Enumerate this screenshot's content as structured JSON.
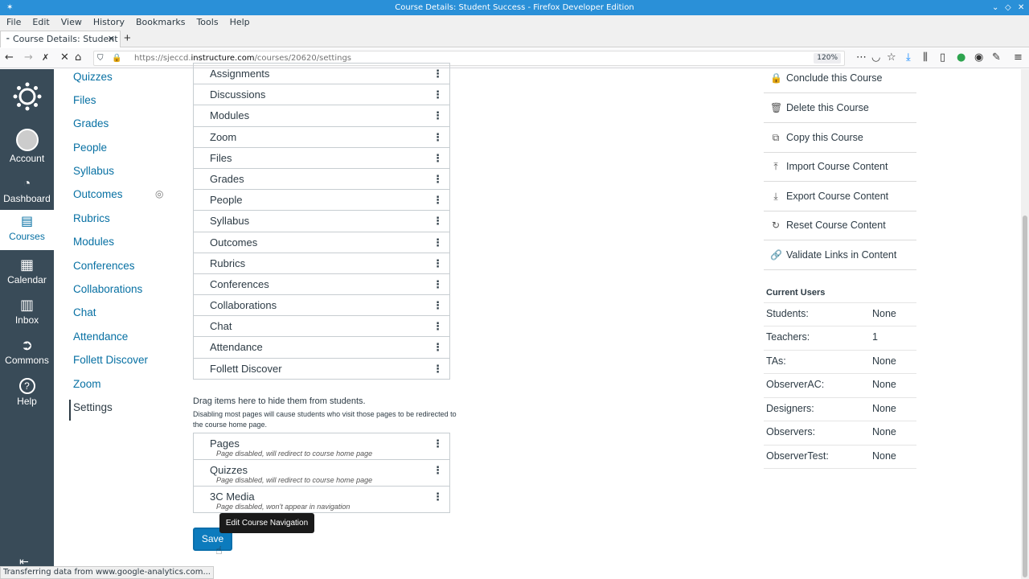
{
  "window": {
    "title": "Course Details: Student Success - Firefox Developer Edition"
  },
  "menubar": [
    "File",
    "Edit",
    "View",
    "History",
    "Bookmarks",
    "Tools",
    "Help"
  ],
  "tab": {
    "title": "Course Details: Student"
  },
  "url": {
    "prefix": "https://sjeccd.",
    "domain": "instructure.com",
    "path": "/courses/20620/settings",
    "zoom": "120%"
  },
  "globalnav": {
    "account": "Account",
    "dashboard": "Dashboard",
    "courses": "Courses",
    "calendar": "Calendar",
    "inbox": "Inbox",
    "commons": "Commons",
    "help": "Help"
  },
  "coursenav": [
    "Quizzes",
    "Files",
    "Grades",
    "People",
    "Syllabus",
    "Outcomes",
    "Rubrics",
    "Modules",
    "Conferences",
    "Collaborations",
    "Chat",
    "Attendance",
    "Follett Discover",
    "Zoom",
    "Settings"
  ],
  "navlist": [
    "Assignments",
    "Discussions",
    "Modules",
    "Zoom",
    "Files",
    "Grades",
    "People",
    "Syllabus",
    "Outcomes",
    "Rubrics",
    "Conferences",
    "Collaborations",
    "Chat",
    "Attendance",
    "Follett Discover"
  ],
  "hidden": {
    "heading": "Drag items here to hide them from students.",
    "note": "Disabling most pages will cause students who visit those pages to be redirected to the course home page.",
    "items": [
      {
        "name": "Pages",
        "sub": "Page disabled, will redirect to course home page"
      },
      {
        "name": "Quizzes",
        "sub": "Page disabled, will redirect to course home page"
      },
      {
        "name": "3C Media",
        "sub": "Page disabled, won't appear in navigation"
      }
    ]
  },
  "save_label": "Save",
  "tooltip": "Edit Course Navigation",
  "sidebar": {
    "links": [
      "Conclude this Course",
      "Delete this Course",
      "Copy this Course",
      "Import Course Content",
      "Export Course Content",
      "Reset Course Content",
      "Validate Links in Content"
    ],
    "current_users_title": "Current Users",
    "users": [
      {
        "role": "Students:",
        "count": "None"
      },
      {
        "role": "Teachers:",
        "count": "1"
      },
      {
        "role": "TAs:",
        "count": "None"
      },
      {
        "role": "ObserverAC:",
        "count": "None"
      },
      {
        "role": "Designers:",
        "count": "None"
      },
      {
        "role": "Observers:",
        "count": "None"
      },
      {
        "role": "ObserverTest:",
        "count": "None"
      }
    ]
  },
  "status": "Transferring data from www.google-analytics.com..."
}
